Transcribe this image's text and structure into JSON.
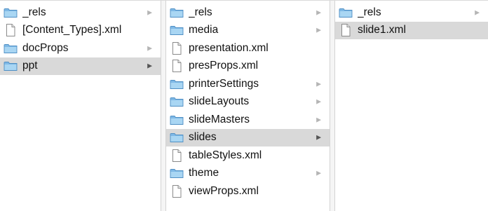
{
  "columns": [
    {
      "items": [
        {
          "label": "_rels",
          "type": "folder",
          "has_children": true,
          "selected": false
        },
        {
          "label": "[Content_Types].xml",
          "type": "file",
          "has_children": false,
          "selected": false
        },
        {
          "label": "docProps",
          "type": "folder",
          "has_children": true,
          "selected": false
        },
        {
          "label": "ppt",
          "type": "folder",
          "has_children": true,
          "selected": true
        }
      ]
    },
    {
      "items": [
        {
          "label": "_rels",
          "type": "folder",
          "has_children": true,
          "selected": false
        },
        {
          "label": "media",
          "type": "folder",
          "has_children": true,
          "selected": false
        },
        {
          "label": "presentation.xml",
          "type": "file",
          "has_children": false,
          "selected": false
        },
        {
          "label": "presProps.xml",
          "type": "file",
          "has_children": false,
          "selected": false
        },
        {
          "label": "printerSettings",
          "type": "folder",
          "has_children": true,
          "selected": false
        },
        {
          "label": "slideLayouts",
          "type": "folder",
          "has_children": true,
          "selected": false
        },
        {
          "label": "slideMasters",
          "type": "folder",
          "has_children": true,
          "selected": false
        },
        {
          "label": "slides",
          "type": "folder",
          "has_children": true,
          "selected": true
        },
        {
          "label": "tableStyles.xml",
          "type": "file",
          "has_children": false,
          "selected": false
        },
        {
          "label": "theme",
          "type": "folder",
          "has_children": true,
          "selected": false
        },
        {
          "label": "viewProps.xml",
          "type": "file",
          "has_children": false,
          "selected": false
        }
      ]
    },
    {
      "items": [
        {
          "label": "_rels",
          "type": "folder",
          "has_children": true,
          "selected": false
        },
        {
          "label": "slide1.xml",
          "type": "file",
          "has_children": false,
          "selected": true
        }
      ]
    }
  ],
  "icons": {
    "folder": "folder-icon",
    "file": "file-icon",
    "chevron": "chevron-right-icon"
  },
  "colors": {
    "selection": "#d9d9d9",
    "folder_top": "#a9d6f3",
    "folder_body": "#7fb9e6",
    "folder_border": "#4f8fc4"
  }
}
